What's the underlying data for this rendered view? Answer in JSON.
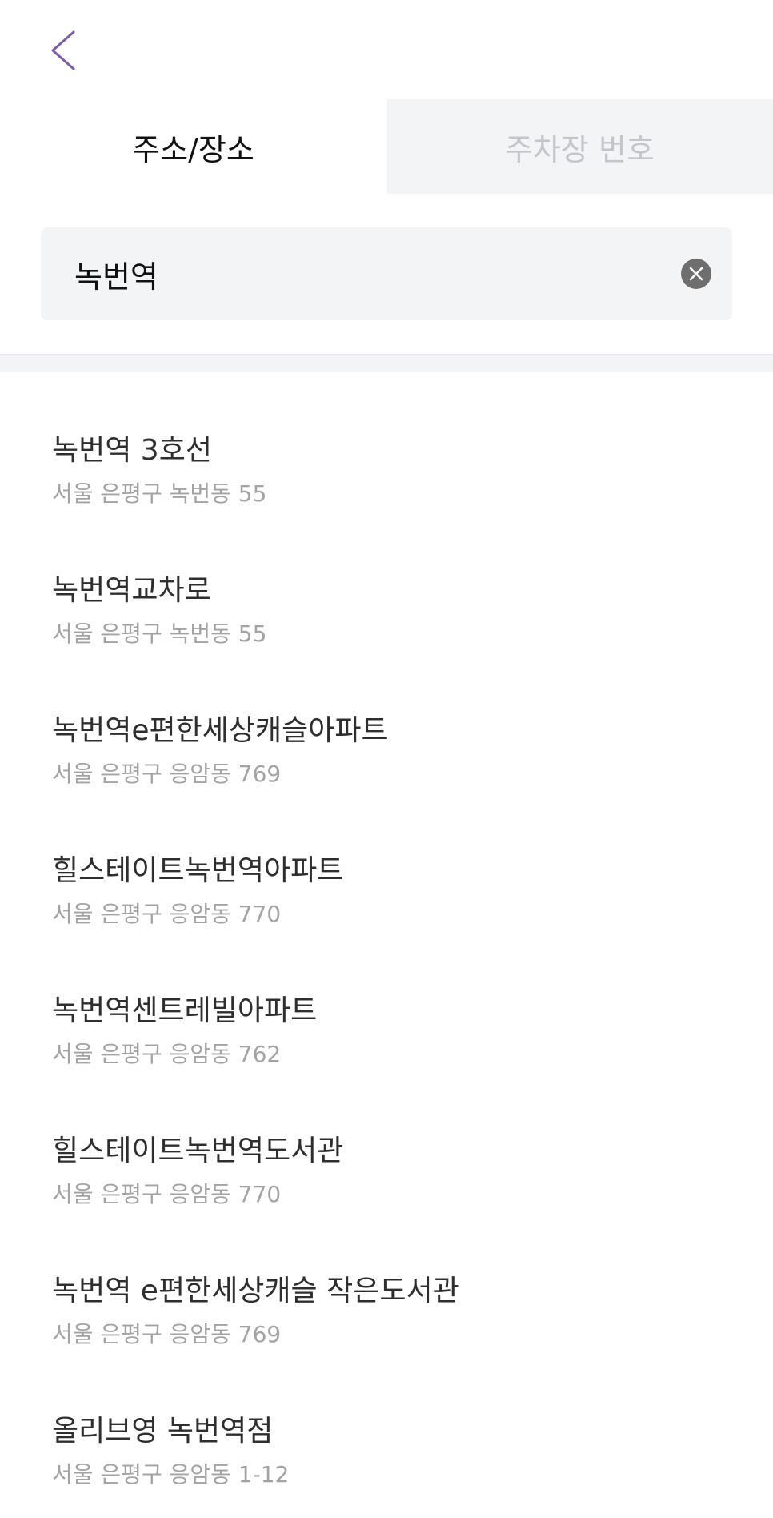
{
  "header": {
    "back_icon": "chevron-left-icon",
    "accent_color": "#7b5ea7"
  },
  "tabs": [
    {
      "label": "주소/장소",
      "active": true
    },
    {
      "label": "주차장 번호",
      "active": false
    }
  ],
  "search": {
    "value": "녹번역",
    "clear_icon": "clear-circle-icon"
  },
  "results": [
    {
      "name": "녹번역 3호선",
      "address": "서울 은평구 녹번동 55"
    },
    {
      "name": "녹번역교차로",
      "address": "서울 은평구 녹번동 55"
    },
    {
      "name": "녹번역e편한세상캐슬아파트",
      "address": "서울 은평구 응암동 769"
    },
    {
      "name": "힐스테이트녹번역아파트",
      "address": "서울 은평구 응암동 770"
    },
    {
      "name": "녹번역센트레빌아파트",
      "address": "서울 은평구 응암동 762"
    },
    {
      "name": "힐스테이트녹번역도서관",
      "address": "서울 은평구 응암동 770"
    },
    {
      "name": "녹번역 e편한세상캐슬 작은도서관",
      "address": "서울 은평구 응암동 769"
    },
    {
      "name": "올리브영 녹번역점",
      "address": "서울 은평구 응암동 1-12"
    }
  ]
}
